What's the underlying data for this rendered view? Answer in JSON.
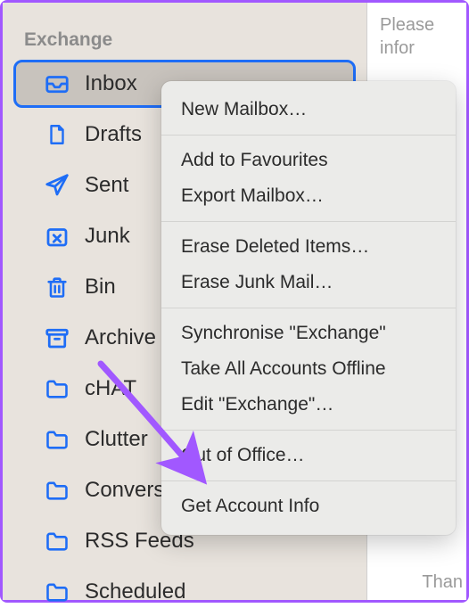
{
  "sidebar": {
    "account": "Exchange",
    "items": [
      {
        "label": "Inbox",
        "icon": "inbox-icon",
        "selected": true
      },
      {
        "label": "Drafts",
        "icon": "document-icon",
        "selected": false
      },
      {
        "label": "Sent",
        "icon": "paperplane-icon",
        "selected": false
      },
      {
        "label": "Junk",
        "icon": "junk-icon",
        "selected": false
      },
      {
        "label": "Bin",
        "icon": "trash-icon",
        "selected": false
      },
      {
        "label": "Archive",
        "icon": "archive-icon",
        "selected": false
      },
      {
        "label": "cHAT",
        "icon": "folder-icon",
        "selected": false
      },
      {
        "label": "Clutter",
        "icon": "folder-icon",
        "selected": false
      },
      {
        "label": "Conversation",
        "icon": "folder-icon",
        "selected": false
      },
      {
        "label": "RSS Feeds",
        "icon": "folder-icon",
        "selected": false
      },
      {
        "label": "Scheduled",
        "icon": "folder-icon",
        "selected": false
      }
    ]
  },
  "content": {
    "snippet_top": "Please infor",
    "snippet_bottom": "Than"
  },
  "context_menu": {
    "groups": [
      [
        "New Mailbox…"
      ],
      [
        "Add to Favourites",
        "Export Mailbox…"
      ],
      [
        "Erase Deleted Items…",
        "Erase Junk Mail…"
      ],
      [
        "Synchronise \"Exchange\"",
        "Take All Accounts Offline",
        "Edit \"Exchange\"…"
      ],
      [
        "Out of Office…"
      ],
      [
        "Get Account Info"
      ]
    ]
  },
  "colors": {
    "icon_blue": "#1e6df6",
    "annotation_purple": "#a158ff"
  }
}
